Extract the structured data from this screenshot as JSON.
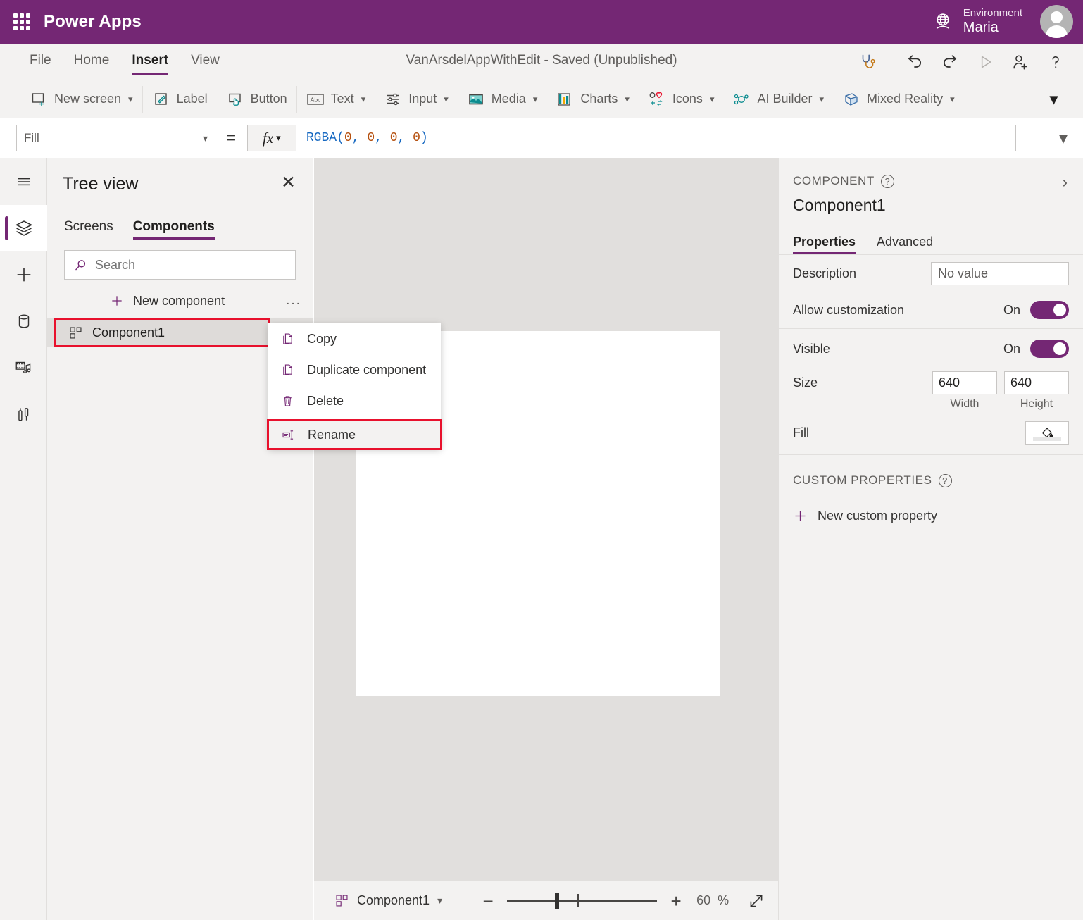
{
  "topbar": {
    "waffle_icon": "waffle-grid-icon",
    "brand": "Power Apps",
    "globe_icon": "environment-globe-icon",
    "environment_label": "Environment",
    "environment_name": "Maria",
    "avatar_icon": "user-avatar"
  },
  "menubar": {
    "items": [
      {
        "label": "File",
        "active": false
      },
      {
        "label": "Home",
        "active": false
      },
      {
        "label": "Insert",
        "active": true
      },
      {
        "label": "View",
        "active": false
      }
    ],
    "doc_title": "VanArsdelAppWithEdit - Saved (Unpublished)",
    "actions": [
      {
        "name": "app-checker-icon",
        "glyph": "stethoscope"
      },
      {
        "name": "undo-icon",
        "glyph": "undo"
      },
      {
        "name": "redo-icon",
        "glyph": "redo"
      },
      {
        "name": "preview-play-icon",
        "glyph": "play"
      },
      {
        "name": "share-add-user-icon",
        "glyph": "person-add"
      },
      {
        "name": "help-question-icon",
        "glyph": "question"
      }
    ]
  },
  "ribbon": {
    "items": [
      {
        "label": "New screen",
        "icon": "new-screen-icon",
        "caret": true
      },
      {
        "label": "Label",
        "icon": "label-icon",
        "caret": false
      },
      {
        "label": "Button",
        "icon": "button-icon",
        "caret": false
      },
      {
        "label": "Text",
        "icon": "text-abc-icon",
        "caret": true
      },
      {
        "label": "Input",
        "icon": "input-sliders-icon",
        "caret": true
      },
      {
        "label": "Media",
        "icon": "media-image-icon",
        "caret": true
      },
      {
        "label": "Charts",
        "icon": "charts-bar-icon",
        "caret": true
      },
      {
        "label": "Icons",
        "icon": "icons-shapes-icon",
        "caret": true
      },
      {
        "label": "AI Builder",
        "icon": "ai-builder-icon",
        "caret": true
      },
      {
        "label": "Mixed Reality",
        "icon": "mixed-reality-icon",
        "caret": true
      }
    ],
    "overflow_icon": "chevron-down-icon"
  },
  "formula_bar": {
    "property": "Fill",
    "equals": "=",
    "fx_label": "fx",
    "formula_function": "RGBA",
    "formula_text": "RGBA(0, 0, 0, 0)",
    "formula_args": [
      "0",
      "0",
      "0",
      "0"
    ],
    "expand_icon": "chevron-down-icon"
  },
  "left_rail": [
    {
      "name": "hamburger-menu-icon",
      "active": false
    },
    {
      "name": "tree-view-layers-icon",
      "active": true
    },
    {
      "name": "insert-plus-icon",
      "active": false
    },
    {
      "name": "data-database-icon",
      "active": false
    },
    {
      "name": "media-library-icon",
      "active": false
    },
    {
      "name": "variables-tools-icon",
      "active": false
    }
  ],
  "tree_view": {
    "title": "Tree view",
    "close_icon": "close-icon",
    "tabs": [
      {
        "label": "Screens",
        "active": false
      },
      {
        "label": "Components",
        "active": true
      }
    ],
    "search": {
      "placeholder": "Search",
      "value": "",
      "icon": "search-icon"
    },
    "new_component": {
      "label": "New component",
      "icon": "plus-icon",
      "ellipsis": "..."
    },
    "component": {
      "label": "Component1",
      "icon": "component-icon",
      "ellipsis": "..."
    }
  },
  "context_menu": {
    "items": [
      {
        "label": "Copy",
        "icon": "copy-icon",
        "highlighted": false
      },
      {
        "label": "Duplicate component",
        "icon": "duplicate-icon",
        "highlighted": false
      },
      {
        "label": "Delete",
        "icon": "trash-icon",
        "highlighted": false
      },
      {
        "label": "Rename",
        "icon": "rename-icon",
        "highlighted": true
      }
    ]
  },
  "status_bar": {
    "component_name": "Component1",
    "component_icon": "component-icon",
    "caret_icon": "chevron-down-icon",
    "zoom_minus": "−",
    "zoom_plus": "+",
    "zoom_value": "60",
    "zoom_unit": "%",
    "fit_icon": "fit-to-screen-icon"
  },
  "properties_panel": {
    "kicker": "COMPONENT",
    "help_icon": "help-icon",
    "collapse_icon": "chevron-right-icon",
    "name": "Component1",
    "tabs": [
      {
        "label": "Properties",
        "active": true
      },
      {
        "label": "Advanced",
        "active": false
      }
    ],
    "rows": {
      "description_label": "Description",
      "description_value": "No value",
      "allow_customization_label": "Allow customization",
      "allow_customization_state": "On",
      "visible_label": "Visible",
      "visible_state": "On",
      "size_label": "Size",
      "size_width": "640",
      "size_height": "640",
      "width_caption": "Width",
      "height_caption": "Height",
      "fill_label": "Fill",
      "fill_icon": "paint-bucket-icon"
    },
    "custom_properties": {
      "title": "CUSTOM PROPERTIES",
      "help_icon": "help-icon",
      "new_property_label": "New custom property",
      "new_property_icon": "plus-icon"
    }
  },
  "colors": {
    "brand_purple": "#742774",
    "highlight_red": "#e8112d",
    "chrome_gray": "#f3f2f1",
    "canvas_gray": "#e1dfdd",
    "teal_icon": "#0b8c8f",
    "formula_blue": "#1668c1",
    "formula_orange": "#b5500f"
  }
}
